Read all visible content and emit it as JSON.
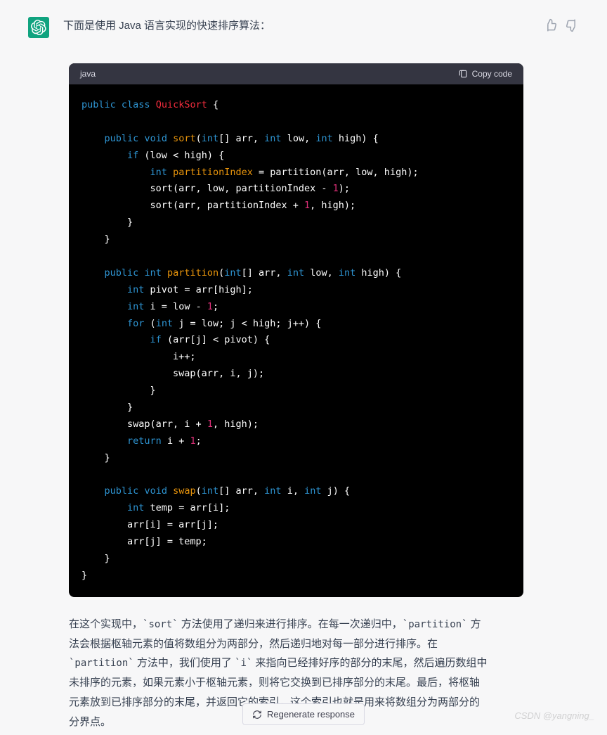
{
  "intro": "下面是使用 Java 语言实现的快速排序算法：",
  "code": {
    "lang": "java",
    "copy_label": "Copy code"
  },
  "tokens": {
    "public": "public",
    "class": "class",
    "QuickSort": "QuickSort",
    "void": "void",
    "sort": "sort",
    "int": "int",
    "if": "if",
    "for": "for",
    "return": "return",
    "partition": "partition",
    "swap": "swap",
    "partitionIndex": "partitionIndex",
    "n1": "1"
  },
  "lines": {
    "l3_tail": "[] arr, ",
    "l3_low": " low, ",
    "l3_high": " high) {",
    "l4_cond": " (low < high) {",
    "l5_assign": " = partition(arr, low, high);",
    "l6": "            sort(arr, low, partitionIndex - ",
    "l6_tail": ");",
    "l7": "            sort(arr, partitionIndex + ",
    "l7_tail": ", high);",
    "p2": " pivot = arr[high];",
    "p3": " i = low - ",
    "p3_tail": ";",
    "p4_head": " (",
    "p4_mid": " j = low; j < high; j++) {",
    "p5_cond": " (arr[j] < pivot) {",
    "p6": "                i++;",
    "p7": "                swap(arr, i, j);",
    "p10": "        swap(arr, i + ",
    "p10_tail": ", high);",
    "p11": " i + ",
    "p11_tail": ";",
    "s1_tail": "[] arr, ",
    "s1_i": " i, ",
    "s1_j": " j) {",
    "s2": " temp = arr[i];",
    "s3": "        arr[i] = arr[j];",
    "s4": "        arr[j] = temp;"
  },
  "explanation": {
    "t1": "在这个实现中，",
    "c1": "`sort`",
    "t2": " 方法使用了递归来进行排序。在每一次递归中，",
    "c2": "`partition`",
    "t3": " 方法会根据枢轴元素的值将数组分为两部分，然后递归地对每一部分进行排序。在 ",
    "c3": "`partition`",
    "t4": " 方法中，我们使用了 ",
    "c4": "`i`",
    "t5": " 来指向已经排好序的部分的末尾，然后遍历数组中未排序的元素，如果元素小于枢轴元素，则将它交换到已排序部分的末尾。最后，将枢轴元素放到已排序部分的末尾，并返回它的索引，这个索引也就是用来将数组分为两部分的分界点。"
  },
  "regenerate": "Regenerate response",
  "watermark": "CSDN @yangning_"
}
